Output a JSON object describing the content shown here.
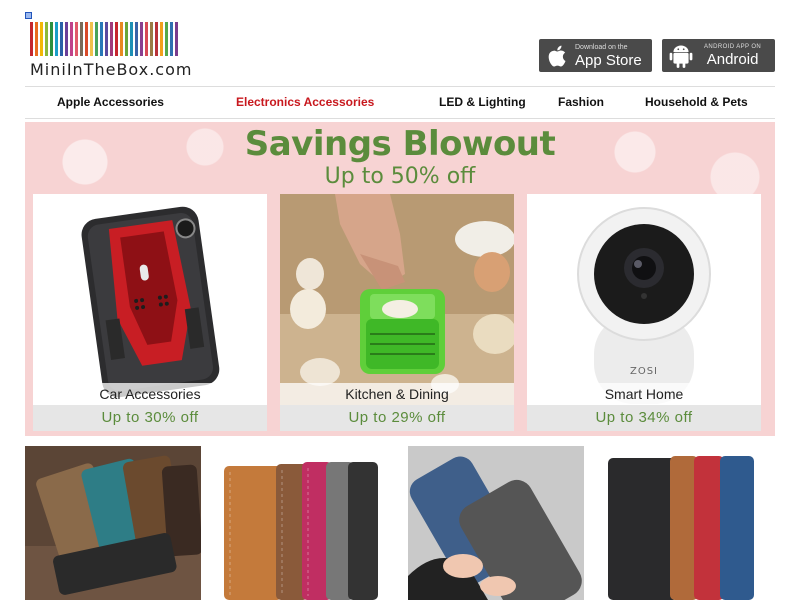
{
  "header": {
    "logo_text": "MiniInTheBox.com",
    "logo_stripe_colors": [
      "#c4262e",
      "#e86b1f",
      "#f2b705",
      "#8bb83b",
      "#2c8f3f",
      "#1a9ec8",
      "#2a5fa8",
      "#6b3f99",
      "#c0428a",
      "#e05a6a",
      "#7a6a58",
      "#d84a2a",
      "#f0c14b",
      "#4aa35a",
      "#2877b8",
      "#5b4a9e",
      "#a13a7a",
      "#c6262e",
      "#e8891f",
      "#6aa63a",
      "#1d8fb5",
      "#3a62a6",
      "#8a3f8f",
      "#d64a55",
      "#9a7b45",
      "#b8323a",
      "#f2a01b",
      "#56a84a",
      "#2f6fb0",
      "#7a3c8c"
    ],
    "app_store": {
      "small": "Download on the",
      "big": "App Store",
      "icon": "apple-icon"
    },
    "android": {
      "small": "ANDROID APP ON",
      "big": "Android",
      "icon": "android-icon"
    }
  },
  "nav": {
    "items": [
      {
        "label": "Apple Accessories",
        "active": false
      },
      {
        "label": "Electronics Accessories",
        "active": true
      },
      {
        "label": "LED & Lighting",
        "active": false
      },
      {
        "label": "Fashion",
        "active": false
      },
      {
        "label": "Household & Pets",
        "active": false
      }
    ]
  },
  "banner": {
    "title": "Savings Blowout",
    "subtitle": "Up to 50% off",
    "cards": [
      {
        "label": "Car Accessories",
        "discount": "Up to 30% off"
      },
      {
        "label": "Kitchen & Dining",
        "discount": "Up to 29% off"
      },
      {
        "label": "Smart Home",
        "discount": "Up to 34% off"
      }
    ],
    "camera_brand": "ZOSI"
  },
  "colors": {
    "accent_green": "#5b8c3c",
    "active_nav": "#c8181e",
    "banner_pink": "#f7d3d3"
  }
}
